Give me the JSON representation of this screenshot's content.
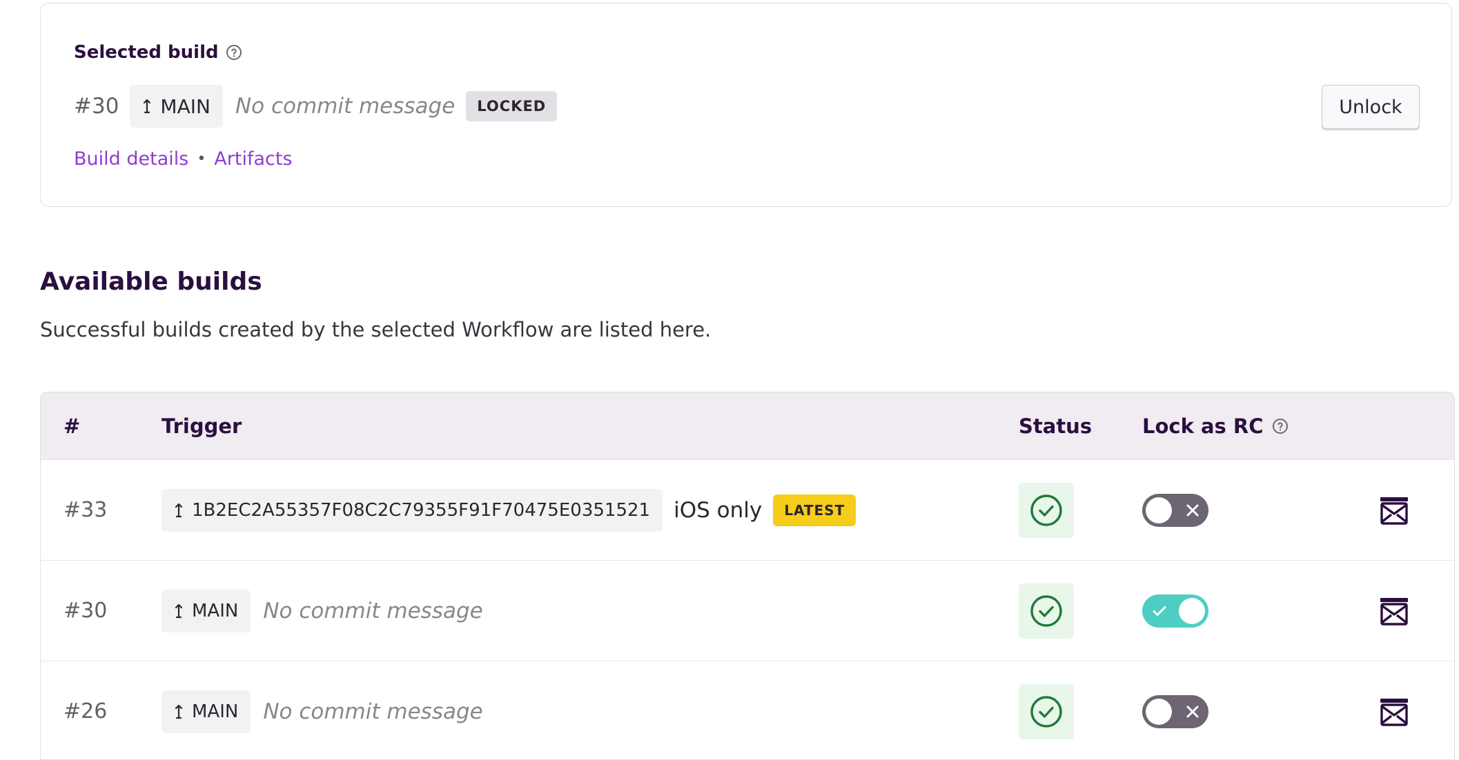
{
  "selected": {
    "title": "Selected build",
    "build_number": "#30",
    "branch": "MAIN",
    "commit_message": "No commit message",
    "status_badge": "LOCKED",
    "links": {
      "build_details": "Build details",
      "separator": "•",
      "artifacts": "Artifacts"
    },
    "unlock_label": "Unlock"
  },
  "available": {
    "title": "Available builds",
    "description": "Successful builds created by the selected Workflow are listed here."
  },
  "table": {
    "headers": {
      "number": "#",
      "trigger": "Trigger",
      "status": "Status",
      "lock": "Lock as RC"
    },
    "rows": [
      {
        "number": "#33",
        "trigger": "1B2EC2A55357F08C2C79355F91F70475E0351521",
        "message": "iOS only",
        "badge": "LATEST",
        "status": "success",
        "locked": false
      },
      {
        "number": "#30",
        "trigger": "MAIN",
        "message": "No commit message",
        "badge": "",
        "status": "success",
        "locked": true
      },
      {
        "number": "#26",
        "trigger": "MAIN",
        "message": "No commit message",
        "badge": "",
        "status": "success",
        "locked": false
      }
    ]
  },
  "colors": {
    "accent_link": "#8e3dd2",
    "toggle_on": "#4ccfc2",
    "toggle_off": "#6d6672",
    "success": "#1f7a3a",
    "latest_badge": "#f5cd1a"
  },
  "icons": {
    "help": "question-circle-icon",
    "branch": "branch-arrow-icon",
    "status": "check-circle-icon",
    "download": "artifact-download-icon"
  }
}
